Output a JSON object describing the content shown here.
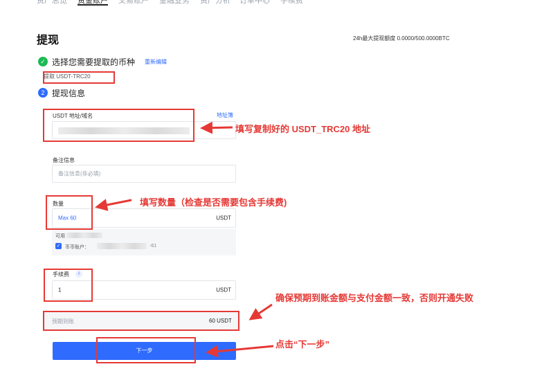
{
  "nav": {
    "tabs": [
      "资产总览",
      "资金账户",
      "交易账户",
      "金融业务",
      "资产分析",
      "订单中心",
      "手续费"
    ],
    "active_index": 1
  },
  "page": {
    "title": "提现",
    "limit_text": "24h最大提现额度 0.0000/500.0000BTC"
  },
  "step1": {
    "label": "选择您需要提取的币种",
    "reedit": "重新编辑",
    "selected": "提取 USDT-TRC20"
  },
  "step2": {
    "number": "2",
    "label": "提现信息"
  },
  "address": {
    "label": "USDT 地址/域名",
    "book_link": "地址簿"
  },
  "memo": {
    "label": "备注信息",
    "placeholder": "备注信息(非必填)"
  },
  "amount": {
    "label": "数量",
    "value": "Max 60",
    "unit": "USDT",
    "available_label": "可用",
    "coin_account_label": "币币账户：",
    "coin_account_value": "-61"
  },
  "fee": {
    "label": "手续费",
    "info_icon": "i",
    "value": "1",
    "unit": "USDT"
  },
  "expected": {
    "label": "预期到账",
    "value": "60 USDT"
  },
  "next_button": "下一步",
  "annotations": {
    "address": "填写复制好的 USDT_TRC20 地址",
    "amount": "填写数量（检查是否需要包含手续费)",
    "expected": "确保预期到账金额与支付金额一致，否则开通失败",
    "next": "点击“下一步”"
  },
  "colors": {
    "accent": "#2f6bff",
    "success": "#1db954",
    "annotation": "#e53935"
  }
}
